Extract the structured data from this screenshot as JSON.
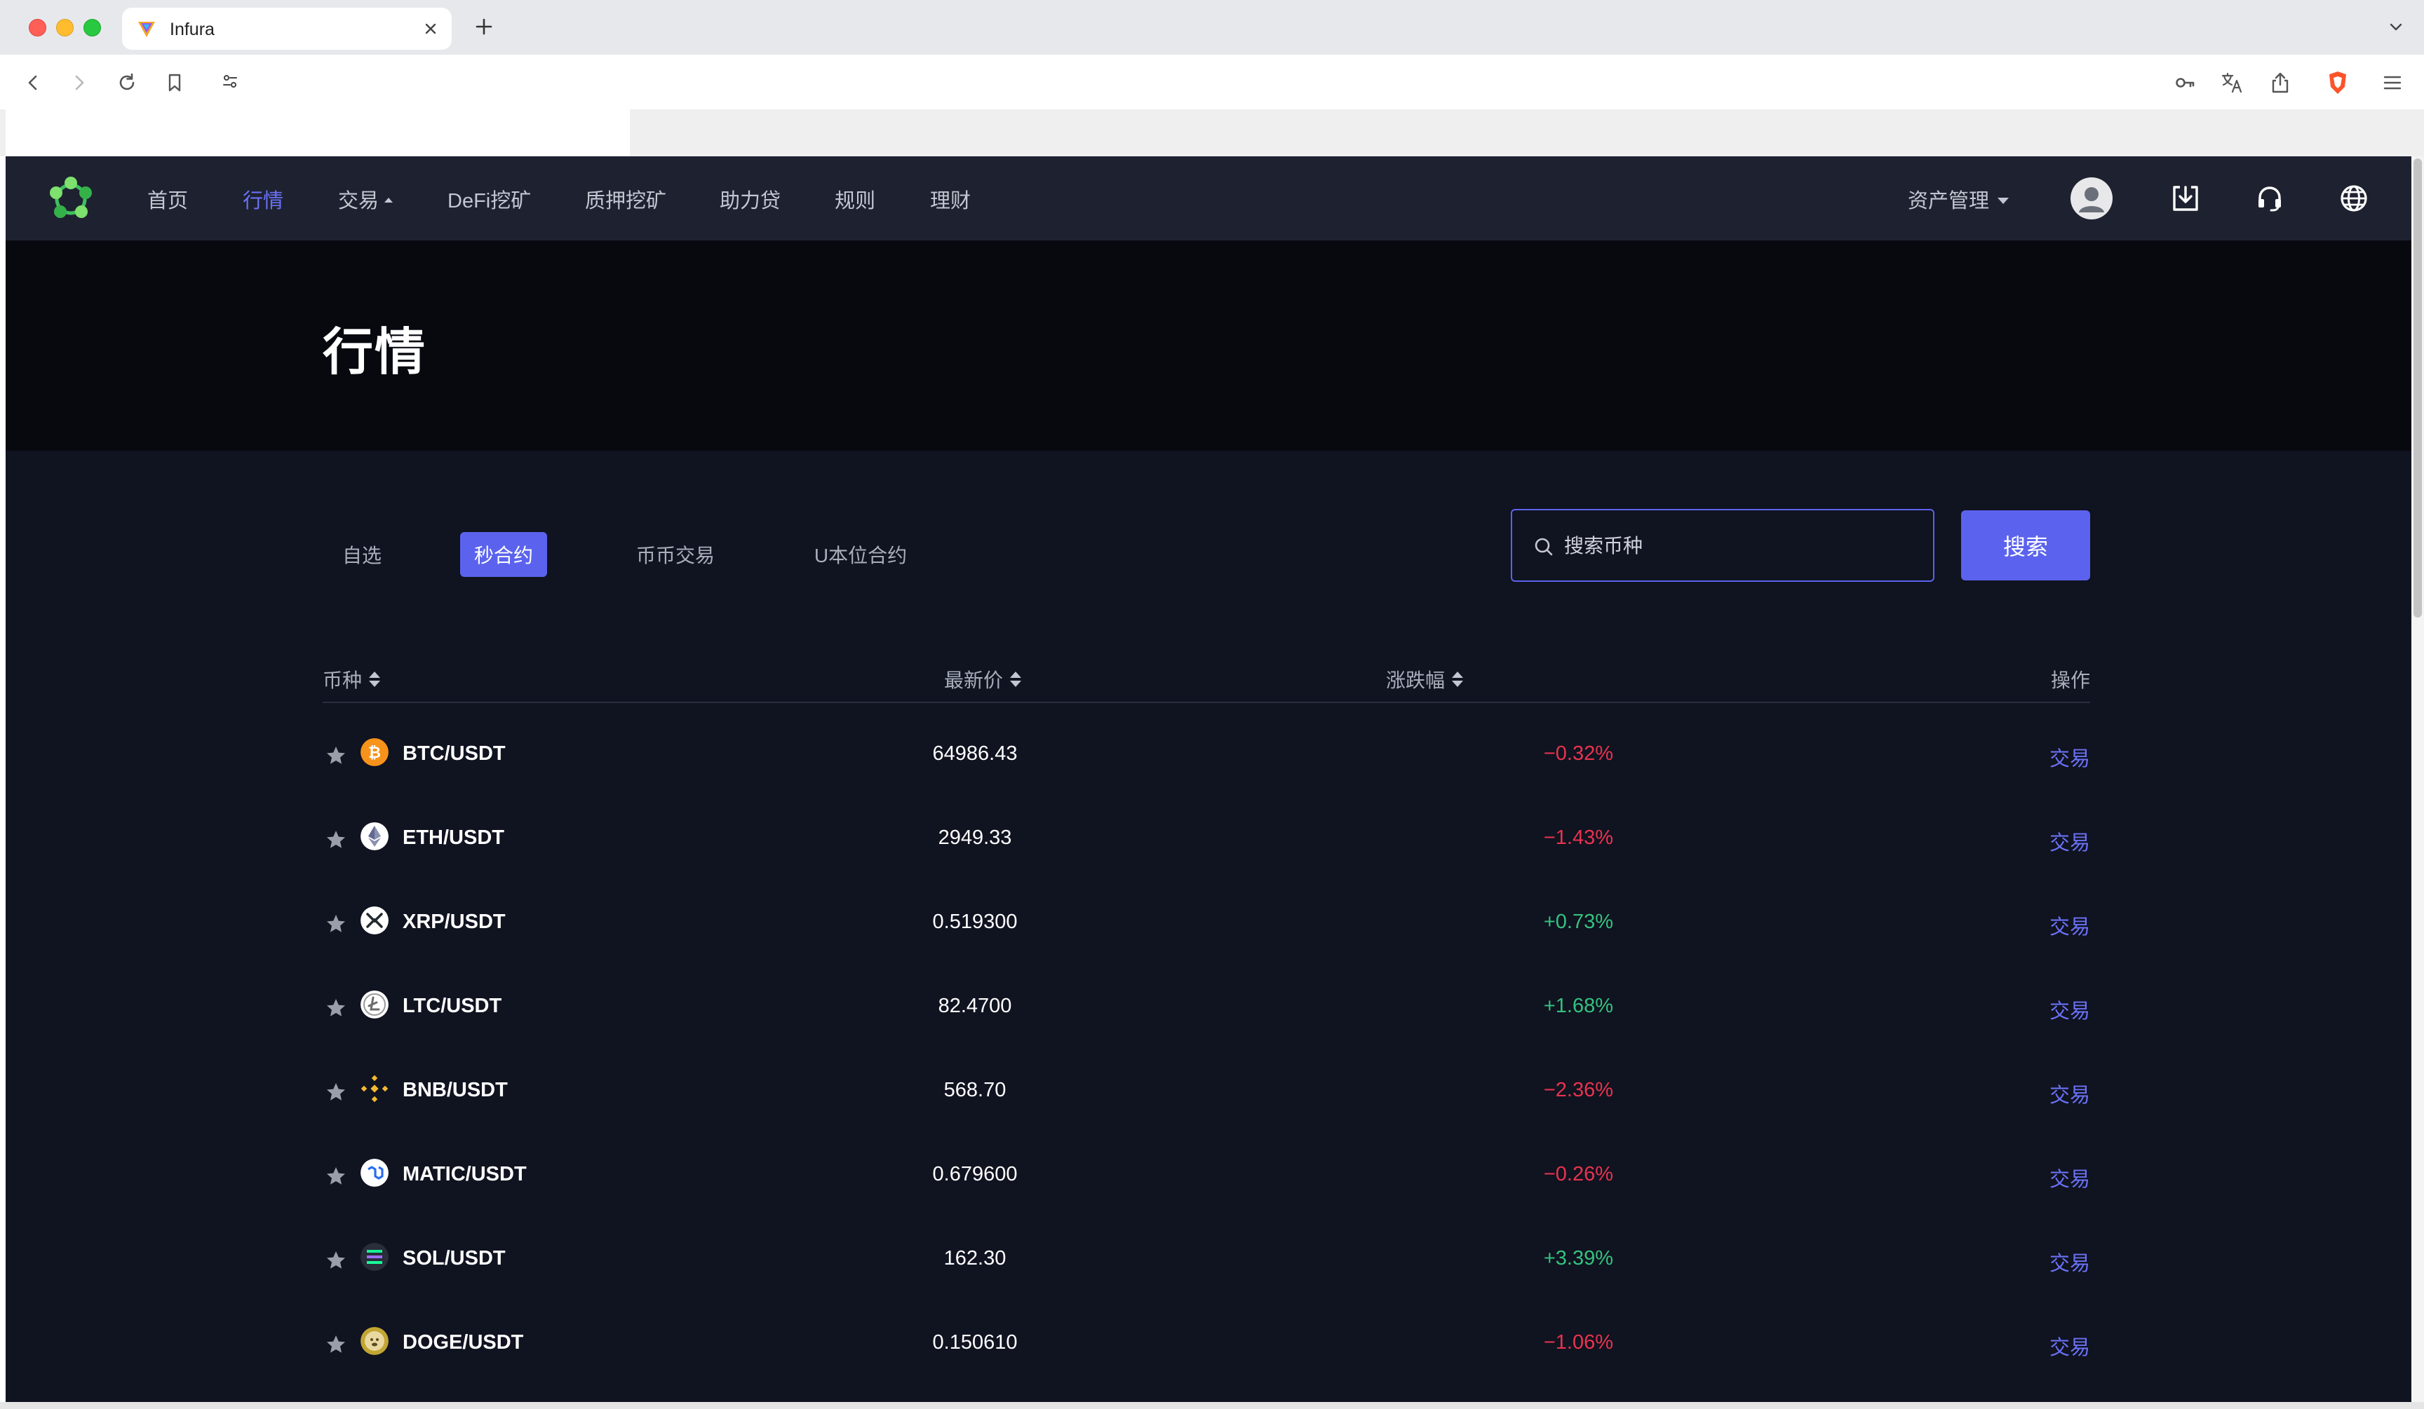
{
  "browser": {
    "tab_title": "Infura",
    "close_glyph": "×",
    "new_tab_glyph": "+"
  },
  "nav": {
    "menu": [
      "首页",
      "行情",
      "交易",
      "DeFi挖矿",
      "质押挖矿",
      "助力贷",
      "规则",
      "理财"
    ],
    "active_index": 1,
    "asset_management": "资产管理",
    "accent": "#6a72f6"
  },
  "page": {
    "title": "行情"
  },
  "filters": {
    "tabs": [
      "自选",
      "秒合约",
      "币币交易",
      "U本位合约"
    ],
    "active_index": 1
  },
  "search": {
    "placeholder": "搜索币种",
    "button_label": "搜索"
  },
  "table": {
    "headers": {
      "coin": "币种",
      "price": "最新价",
      "change": "涨跌幅",
      "action": "操作"
    },
    "rows": [
      {
        "pair": "BTC/USDT",
        "price": "64986.43",
        "change": "−0.32%",
        "direction": "down",
        "icon": "btc-icon",
        "action": "交易"
      },
      {
        "pair": "ETH/USDT",
        "price": "2949.33",
        "change": "−1.43%",
        "direction": "down",
        "icon": "eth-icon",
        "action": "交易"
      },
      {
        "pair": "XRP/USDT",
        "price": "0.519300",
        "change": "+0.73%",
        "direction": "up",
        "icon": "xrp-icon",
        "action": "交易"
      },
      {
        "pair": "LTC/USDT",
        "price": "82.4700",
        "change": "+1.68%",
        "direction": "up",
        "icon": "ltc-icon",
        "action": "交易"
      },
      {
        "pair": "BNB/USDT",
        "price": "568.70",
        "change": "−2.36%",
        "direction": "down",
        "icon": "bnb-icon",
        "action": "交易"
      },
      {
        "pair": "MATIC/USDT",
        "price": "0.679600",
        "change": "−0.26%",
        "direction": "down",
        "icon": "matic-icon",
        "action": "交易"
      },
      {
        "pair": "SOL/USDT",
        "price": "162.30",
        "change": "+3.39%",
        "direction": "up",
        "icon": "sol-icon",
        "action": "交易"
      },
      {
        "pair": "DOGE/USDT",
        "price": "0.150610",
        "change": "−1.06%",
        "direction": "down",
        "icon": "doge-icon",
        "action": "交易"
      }
    ],
    "colors": {
      "up": "#34c27e",
      "down": "#e8334f",
      "action": "#6a72f6"
    }
  }
}
